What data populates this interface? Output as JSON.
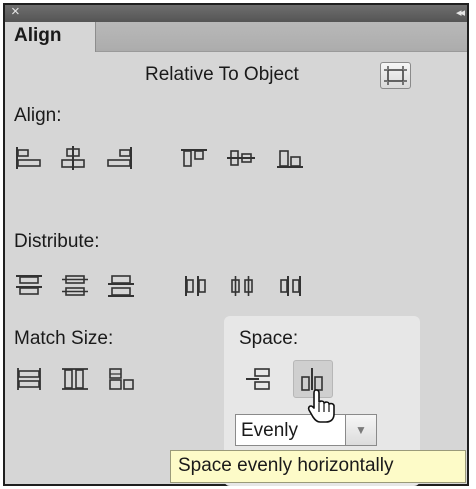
{
  "titlebar": {
    "close_glyph": "×",
    "collapse_glyph": "◂◂"
  },
  "tabs": [
    {
      "label": "Align"
    }
  ],
  "relative": {
    "label": "Relative To Object",
    "icon": "relative-to-object-icon"
  },
  "sections": {
    "align": {
      "label": "Align:"
    },
    "distribute": {
      "label": "Distribute:"
    },
    "match_size": {
      "label": "Match Size:"
    },
    "space": {
      "label": "Space:"
    }
  },
  "space_dropdown": {
    "value": "Evenly"
  },
  "tooltip": {
    "text": "Space evenly horizontally"
  },
  "colors": {
    "panel": "#d6d6d6",
    "tooltip_bg": "#fdfbc8",
    "icon": "#3a3a3a"
  }
}
